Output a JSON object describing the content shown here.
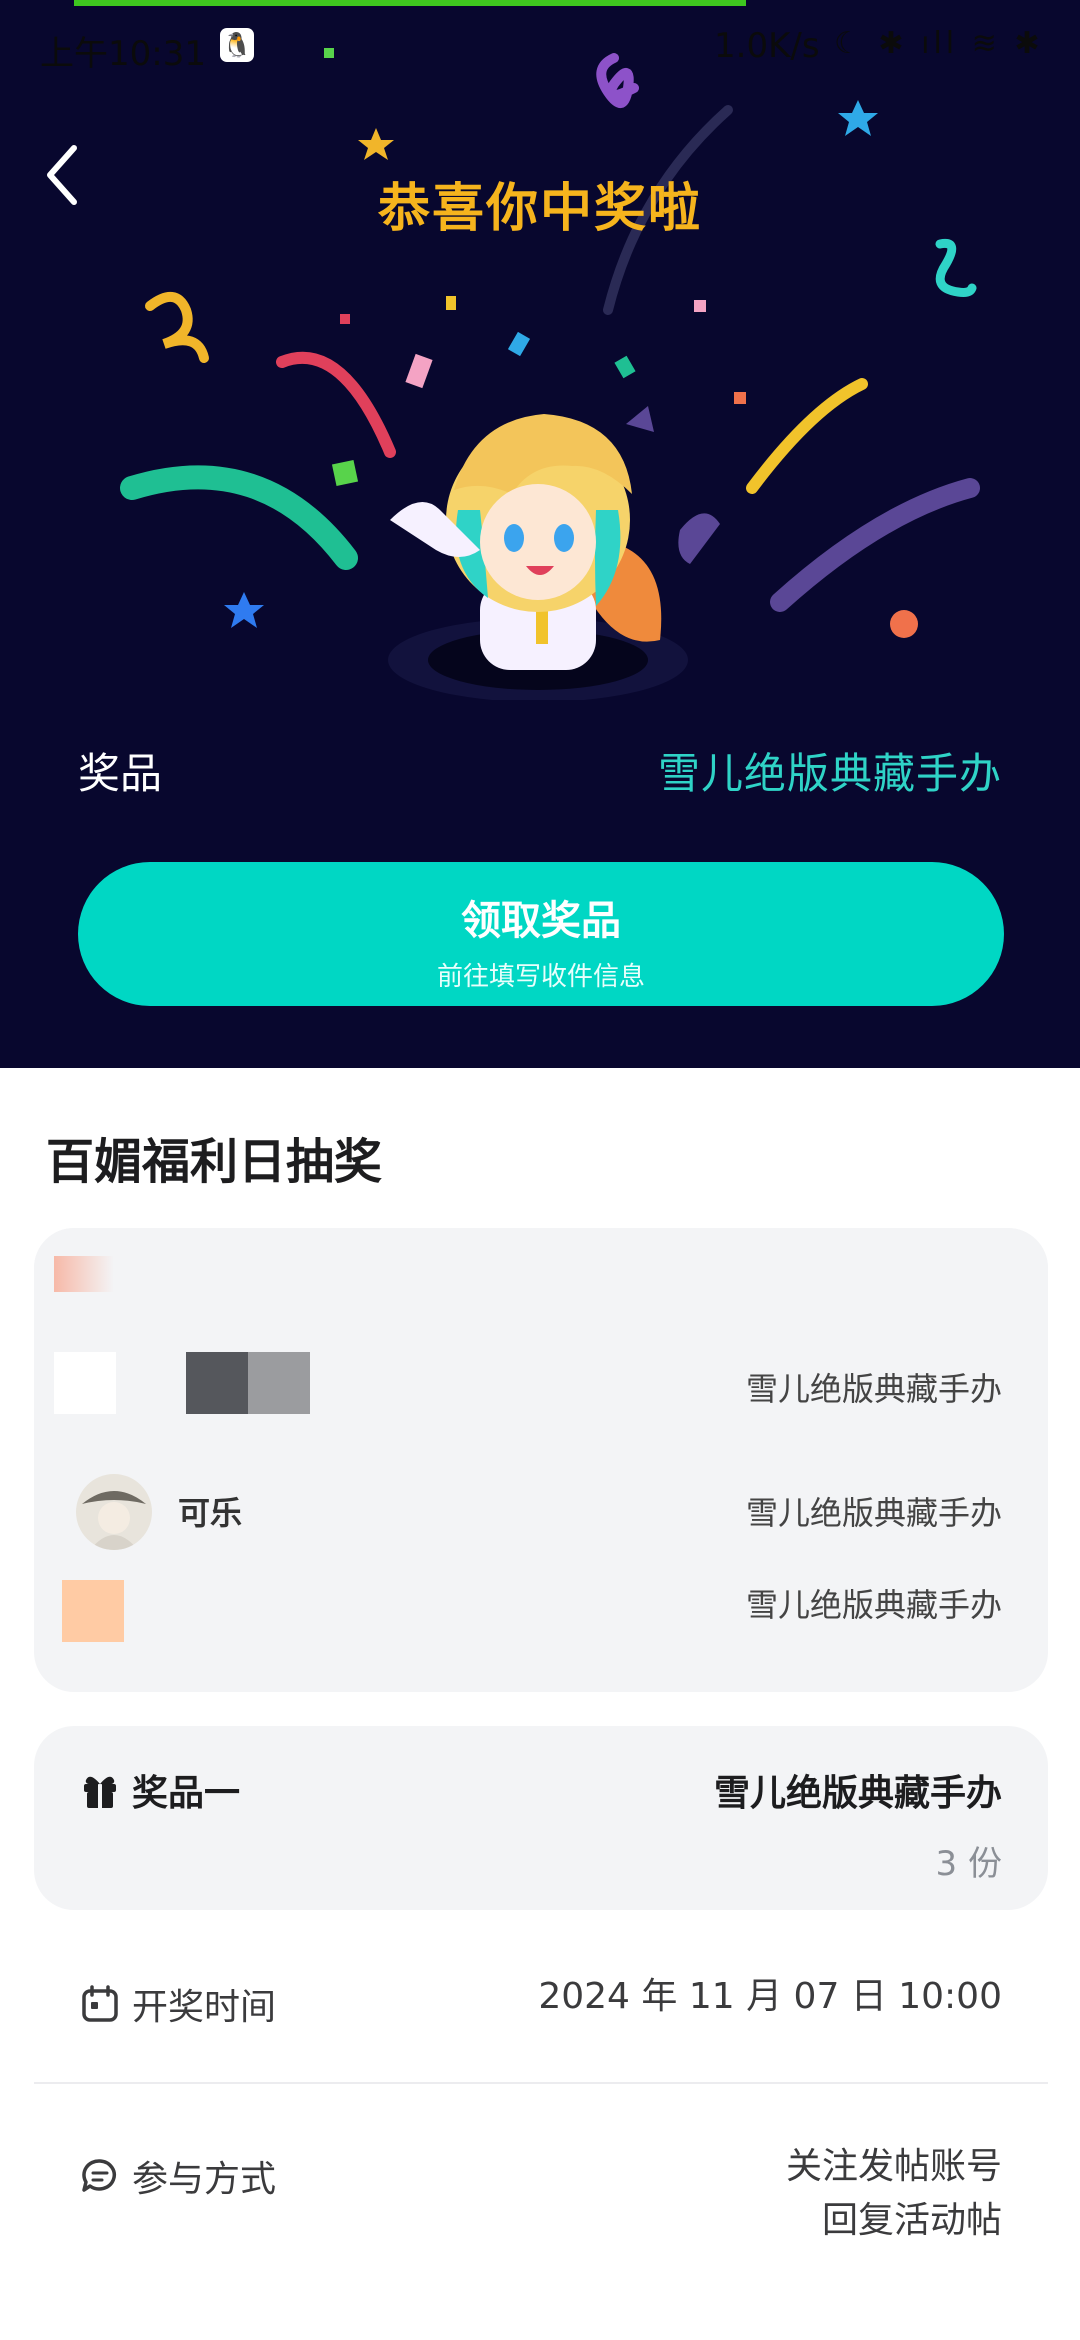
{
  "status_bar": {
    "time": "上午10:31",
    "network_speed": "1.0K/s",
    "indicators": "☾ ✱ ıll ≋ ✱"
  },
  "hero": {
    "headline": "恭喜你中奖啦",
    "prize_label": "奖品",
    "prize_value": "雪儿绝版典藏手办",
    "claim_button": {
      "title": "领取奖品",
      "subtitle": "前往填写收件信息"
    }
  },
  "lottery": {
    "title": "百媚福利日抽奖",
    "winners": [
      {
        "name": "",
        "prize": "雪儿绝版典藏手办"
      },
      {
        "name": "可乐",
        "prize": "雪儿绝版典藏手办"
      },
      {
        "name": "",
        "prize": "雪儿绝版典藏手办"
      }
    ],
    "prize_tier": {
      "label": "奖品一",
      "name": "雪儿绝版典藏手办",
      "count": "3 份"
    },
    "draw_time": {
      "label": "开奖时间",
      "value": "2024 年 11 月 07 日 10:00"
    },
    "participation": {
      "label": "参与方式",
      "line1": "关注发帖账号",
      "line2": "回复活动帖"
    }
  },
  "colors": {
    "hero_bg": "#08072e",
    "accent": "#00d7c4",
    "headline": "#f6b41d",
    "prize_value": "#2fd3c7"
  },
  "icons": {
    "back": "chevron-left-icon",
    "gift": "gift-icon",
    "calendar": "calendar-icon",
    "chat": "chat-bubble-icon"
  }
}
